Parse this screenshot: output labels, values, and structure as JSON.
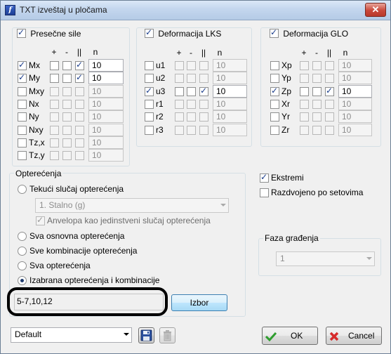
{
  "window": {
    "title": "TXT izveštaj u pločama",
    "close_label": "✕"
  },
  "presecne": {
    "label": "Presečne sile",
    "checked": true,
    "headers": [
      "+",
      "-",
      "||",
      "n"
    ],
    "rows": [
      {
        "label": "Mx",
        "checked": true,
        "plus": false,
        "minus": false,
        "abs": true,
        "n": "10",
        "enabled": true
      },
      {
        "label": "My",
        "checked": true,
        "plus": false,
        "minus": false,
        "abs": true,
        "n": "10",
        "enabled": true
      },
      {
        "label": "Mxy",
        "checked": false,
        "plus": false,
        "minus": false,
        "abs": false,
        "n": "10",
        "enabled": false
      },
      {
        "label": "Nx",
        "checked": false,
        "plus": false,
        "minus": false,
        "abs": false,
        "n": "10",
        "enabled": false
      },
      {
        "label": "Ny",
        "checked": false,
        "plus": false,
        "minus": false,
        "abs": false,
        "n": "10",
        "enabled": false
      },
      {
        "label": "Nxy",
        "checked": false,
        "plus": false,
        "minus": false,
        "abs": false,
        "n": "10",
        "enabled": false
      },
      {
        "label": "Tz,x",
        "checked": false,
        "plus": false,
        "minus": false,
        "abs": false,
        "n": "10",
        "enabled": false
      },
      {
        "label": "Tz,y",
        "checked": false,
        "plus": false,
        "minus": false,
        "abs": false,
        "n": "10",
        "enabled": false
      }
    ]
  },
  "lks": {
    "label": "Deformacija LKS",
    "checked": true,
    "headers": [
      "+",
      "-",
      "||",
      "n"
    ],
    "rows": [
      {
        "label": "u1",
        "checked": false,
        "plus": false,
        "minus": false,
        "abs": false,
        "n": "10",
        "enabled": false
      },
      {
        "label": "u2",
        "checked": false,
        "plus": false,
        "minus": false,
        "abs": false,
        "n": "10",
        "enabled": false
      },
      {
        "label": "u3",
        "checked": true,
        "plus": false,
        "minus": false,
        "abs": true,
        "n": "10",
        "enabled": true
      },
      {
        "label": "r1",
        "checked": false,
        "plus": false,
        "minus": false,
        "abs": false,
        "n": "10",
        "enabled": false
      },
      {
        "label": "r2",
        "checked": false,
        "plus": false,
        "minus": false,
        "abs": false,
        "n": "10",
        "enabled": false
      },
      {
        "label": "r3",
        "checked": false,
        "plus": false,
        "minus": false,
        "abs": false,
        "n": "10",
        "enabled": false
      }
    ]
  },
  "glo": {
    "label": "Deformacija GLO",
    "checked": true,
    "headers": [
      "+",
      "-",
      "||",
      "n"
    ],
    "rows": [
      {
        "label": "Xp",
        "checked": false,
        "plus": false,
        "minus": false,
        "abs": false,
        "n": "10",
        "enabled": false
      },
      {
        "label": "Yp",
        "checked": false,
        "plus": false,
        "minus": false,
        "abs": false,
        "n": "10",
        "enabled": false
      },
      {
        "label": "Zp",
        "checked": true,
        "plus": false,
        "minus": false,
        "abs": true,
        "n": "10",
        "enabled": true
      },
      {
        "label": "Xr",
        "checked": false,
        "plus": false,
        "minus": false,
        "abs": false,
        "n": "10",
        "enabled": false
      },
      {
        "label": "Yr",
        "checked": false,
        "plus": false,
        "minus": false,
        "abs": false,
        "n": "10",
        "enabled": false
      },
      {
        "label": "Zr",
        "checked": false,
        "plus": false,
        "minus": false,
        "abs": false,
        "n": "10",
        "enabled": false
      }
    ]
  },
  "opterecenja": {
    "title": "Opterećenja",
    "radio_tekuci": "Tekući slučaj opterećenja",
    "tekuci_combo": "1. Stalno (g)",
    "anvelopa": "Anvelopa kao jedinstveni slučaj opterećenja",
    "radio_osnovna": "Sva osnovna opterećenja",
    "radio_kombinacije": "Sve kombinacije opterećenja",
    "radio_sva": "Sva opterećenja",
    "radio_izabrana": "Izabrana opterećenja i kombinacije",
    "selected": "izabrana",
    "selection_value": "5-7,10,12",
    "izbor_button": "Izbor"
  },
  "options": {
    "ekstremi": "Ekstremi",
    "ekstremi_checked": true,
    "razdvojeno": "Razdvojeno po setovima",
    "razdvojeno_checked": false
  },
  "faza": {
    "title": "Faza građenja",
    "value": "1"
  },
  "footer": {
    "preset": "Default",
    "ok": "OK",
    "cancel": "Cancel"
  },
  "colors": {
    "accent": "#1e3a6d",
    "highlight_ring": "#000000",
    "ok_icon": "#2e9d2e",
    "cancel_icon": "#d62a2a"
  }
}
